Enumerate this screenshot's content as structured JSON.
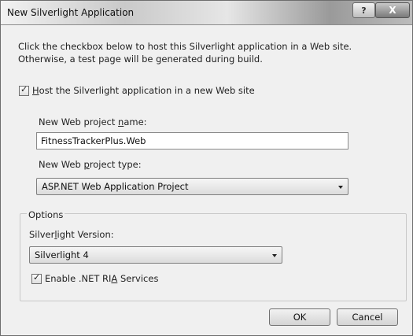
{
  "window": {
    "title": "New Silverlight Application",
    "help_label": "?",
    "close_label": "X"
  },
  "description": "Click the checkbox below to host this Silverlight application in a Web site. Otherwise, a test page will be generated during build.",
  "host_checkbox": {
    "checked": true,
    "label_pre": "",
    "label_key": "H",
    "label_post": "ost the Silverlight application in a new Web site"
  },
  "project_name": {
    "label_pre": "New Web project ",
    "label_key": "n",
    "label_post": "ame:",
    "value": "FitnessTrackerPlus.Web"
  },
  "project_type": {
    "label_pre": "New Web ",
    "label_key": "p",
    "label_post": "roject type:",
    "value": "ASP.NET Web Application Project"
  },
  "options": {
    "legend": "Options",
    "version_label_pre": "Silver",
    "version_label_key": "l",
    "version_label_post": "ight Version:",
    "version_value": "Silverlight 4",
    "ria_checked": true,
    "ria_label_pre": "Enable .NET RI",
    "ria_label_key": "A",
    "ria_label_post": " Services"
  },
  "buttons": {
    "ok": "OK",
    "cancel": "Cancel"
  },
  "icons": {
    "checkmark": "✓"
  }
}
